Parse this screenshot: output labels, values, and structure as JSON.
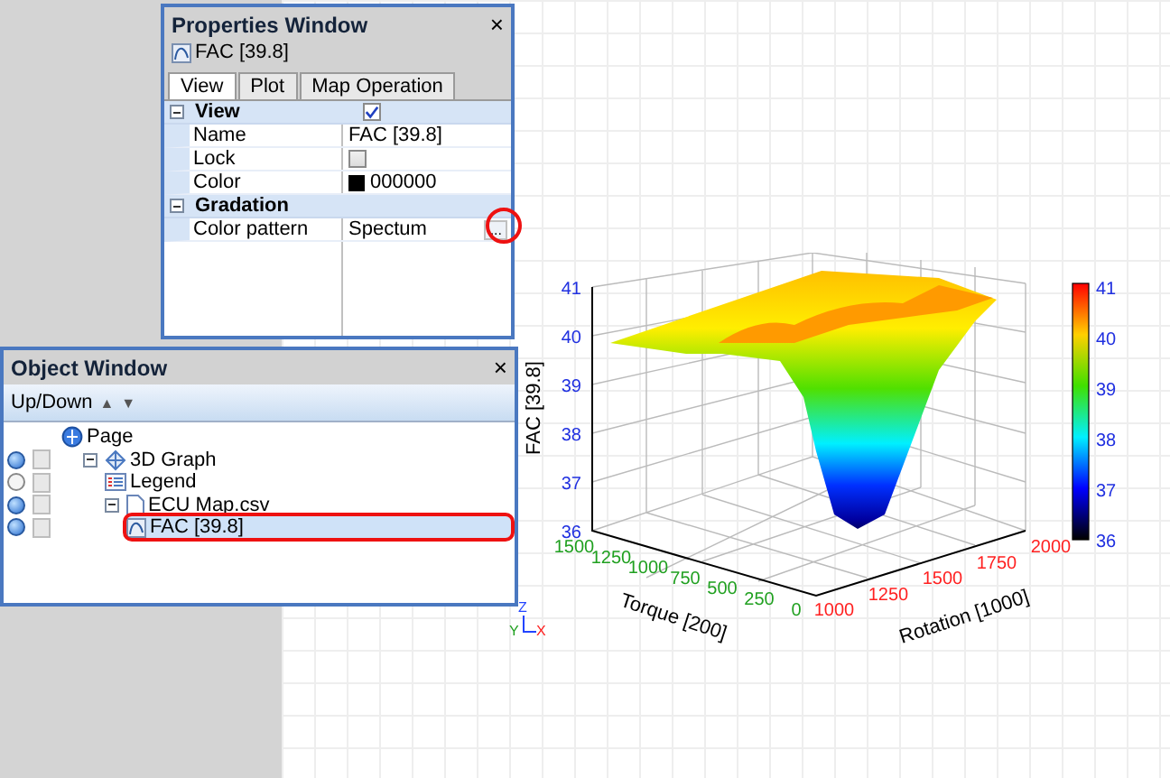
{
  "properties_window": {
    "title": "Properties Window",
    "close": "×",
    "object": "FAC [39.8]",
    "tabs": [
      {
        "label": "View",
        "selected": true
      },
      {
        "label": "Plot",
        "selected": false
      },
      {
        "label": "Map Operation",
        "selected": false
      }
    ],
    "categories": [
      {
        "name": "View",
        "expanded": true,
        "checked": true,
        "items": [
          {
            "kind": "text",
            "name": "Name",
            "value": "FAC [39.8]"
          },
          {
            "kind": "checkbox",
            "name": "Lock",
            "checked": false
          },
          {
            "kind": "color",
            "name": "Color",
            "color": "#000000",
            "value": "000000"
          }
        ]
      },
      {
        "name": "Gradation",
        "expanded": true,
        "items": [
          {
            "kind": "button",
            "name": "Color pattern",
            "value": "Spectum",
            "button": "...",
            "highlighted": true
          }
        ]
      }
    ]
  },
  "object_window": {
    "title": "Object Window",
    "close": "×",
    "toolbar": {
      "label": "Up/Down",
      "up": "▲",
      "down": "▼"
    },
    "tree": [
      {
        "label": "Page",
        "kind": "page",
        "selected": false,
        "children": [
          {
            "label": "3D Graph",
            "kind": "graph",
            "visible": true,
            "checked": false,
            "expanded": true,
            "selected": false,
            "children": [
              {
                "label": "Legend",
                "kind": "legend",
                "visible": false,
                "checked": false,
                "selected": false
              },
              {
                "label": "ECU Map.csv",
                "kind": "file",
                "visible": true,
                "checked": false,
                "expanded": true,
                "selected": false,
                "children": [
                  {
                    "label": "FAC [39.8]",
                    "kind": "curve",
                    "visible": true,
                    "checked": false,
                    "selected": true,
                    "highlighted": true
                  }
                ]
              }
            ]
          }
        ]
      }
    ]
  },
  "graph": {
    "z_title": "FAC [39.8]",
    "z_ticks": [
      "41",
      "40",
      "39",
      "38",
      "37",
      "36"
    ],
    "torque_title": "Torque [200]",
    "torque_ticks": [
      "1500",
      "1250",
      "1000",
      "750",
      "500",
      "250",
      "0"
    ],
    "rotation_title": "Rotation [1000]",
    "rotation_ticks": [
      "1000",
      "1250",
      "1500",
      "1750",
      "2000"
    ],
    "colorbar_ticks": [
      "41",
      "40",
      "39",
      "38",
      "37",
      "36"
    ],
    "gizmo": [
      "Z",
      "Y",
      "X"
    ]
  }
}
